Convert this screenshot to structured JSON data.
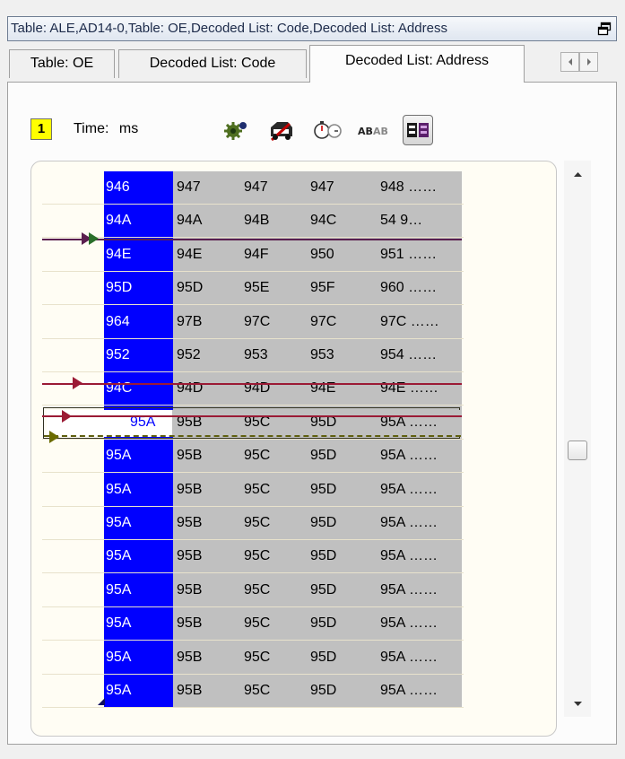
{
  "window": {
    "title": "Table: ALE,AD14-0,Table: OE,Decoded List: Code,Decoded List: Address"
  },
  "tabs": [
    {
      "label": "Table: OE"
    },
    {
      "label": "Decoded List: Code"
    },
    {
      "label": "Decoded List: Address",
      "active": true
    }
  ],
  "toolbar": {
    "frame_number": "1",
    "time_label": "Time:",
    "time_unit": "ms",
    "icons": [
      "gear-icon",
      "car-icon",
      "stopwatch-icon",
      "ab-compare-icon",
      "waveform-view-icon"
    ]
  },
  "colors": {
    "address_column": "#0000ff",
    "data_cells": "#c0c0c0",
    "grid_background": "#fffdf4",
    "trace_purple": "#5a1f4f",
    "trace_red": "#9b1a35",
    "trace_olive": "#6b6b00"
  },
  "rows": [
    {
      "address": "946",
      "values": [
        "947",
        "947",
        "947",
        "948 ……"
      ]
    },
    {
      "address": "94A",
      "values": [
        "94A",
        "94B",
        "94C",
        "54   9…"
      ]
    },
    {
      "address": "94E",
      "values": [
        "94E",
        "94F",
        "950",
        "951 ……"
      ]
    },
    {
      "address": "95D",
      "values": [
        "95D",
        "95E",
        "95F",
        "960 ……"
      ]
    },
    {
      "address": "964",
      "values": [
        "97B",
        "97C",
        "97C",
        "97C ……"
      ]
    },
    {
      "address": "952",
      "values": [
        "952",
        "953",
        "953",
        "954 ……"
      ]
    },
    {
      "address": "94C",
      "values": [
        "94D",
        "94D",
        "94E",
        "94E ……"
      ]
    },
    {
      "address": "95A",
      "values": [
        "95B",
        "95C",
        "95D",
        "95A ……"
      ],
      "selected": true
    },
    {
      "address": "95A",
      "values": [
        "95B",
        "95C",
        "95D",
        "95A ……"
      ]
    },
    {
      "address": "95A",
      "values": [
        "95B",
        "95C",
        "95D",
        "95A ……"
      ]
    },
    {
      "address": "95A",
      "values": [
        "95B",
        "95C",
        "95D",
        "95A ……"
      ]
    },
    {
      "address": "95A",
      "values": [
        "95B",
        "95C",
        "95D",
        "95A ……"
      ]
    },
    {
      "address": "95A",
      "values": [
        "95B",
        "95C",
        "95D",
        "95A ……"
      ]
    },
    {
      "address": "95A",
      "values": [
        "95B",
        "95C",
        "95D",
        "95A ……"
      ]
    },
    {
      "address": "95A",
      "values": [
        "95B",
        "95C",
        "95D",
        "95A ……"
      ]
    },
    {
      "address": "95A",
      "values": [
        "95B",
        "95C",
        "95D",
        "95A ……"
      ]
    }
  ],
  "scrollbar": {
    "position": 0.5
  }
}
